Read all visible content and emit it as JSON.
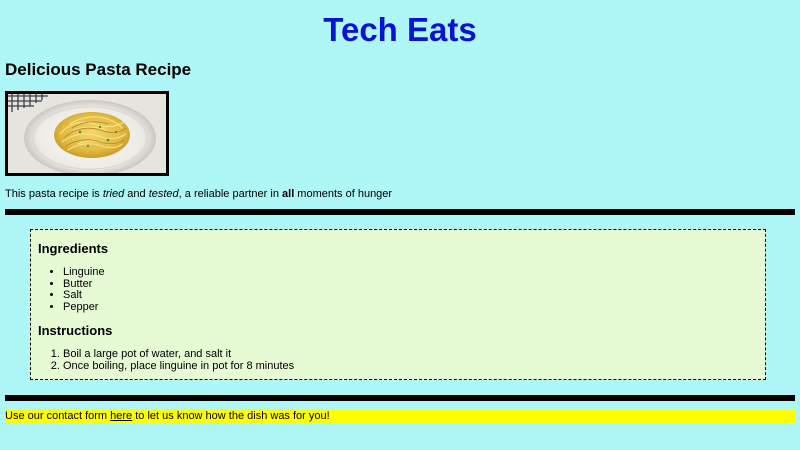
{
  "header": {
    "site_title": "Tech Eats"
  },
  "recipe": {
    "title": "Delicious Pasta Recipe",
    "photo_icon": "pasta-dish-photo",
    "intro": {
      "part1": "This pasta recipe is ",
      "em1": "tried",
      "part2": " and ",
      "em2": "tested",
      "part3": ", a reliable partner in ",
      "strong": "all",
      "part4": " moments of hunger"
    }
  },
  "ingredients": {
    "heading": "Ingredients",
    "items": [
      "Linguine",
      "Butter",
      "Salt",
      "Pepper"
    ]
  },
  "instructions": {
    "heading": "Instructions",
    "steps": [
      "Boil a large pot of water, and salt it",
      "Once boiling, place linguine in pot for 8 minutes"
    ]
  },
  "footer": {
    "before_link": "Use our contact form ",
    "link_text": "here",
    "after_link": " to let us know how the dish was for you!"
  },
  "colors": {
    "page_background": "#aff6f6",
    "title": "#0b12d4",
    "recipe_box": "#e6fbd4",
    "footer_highlight": "#ffff00"
  }
}
